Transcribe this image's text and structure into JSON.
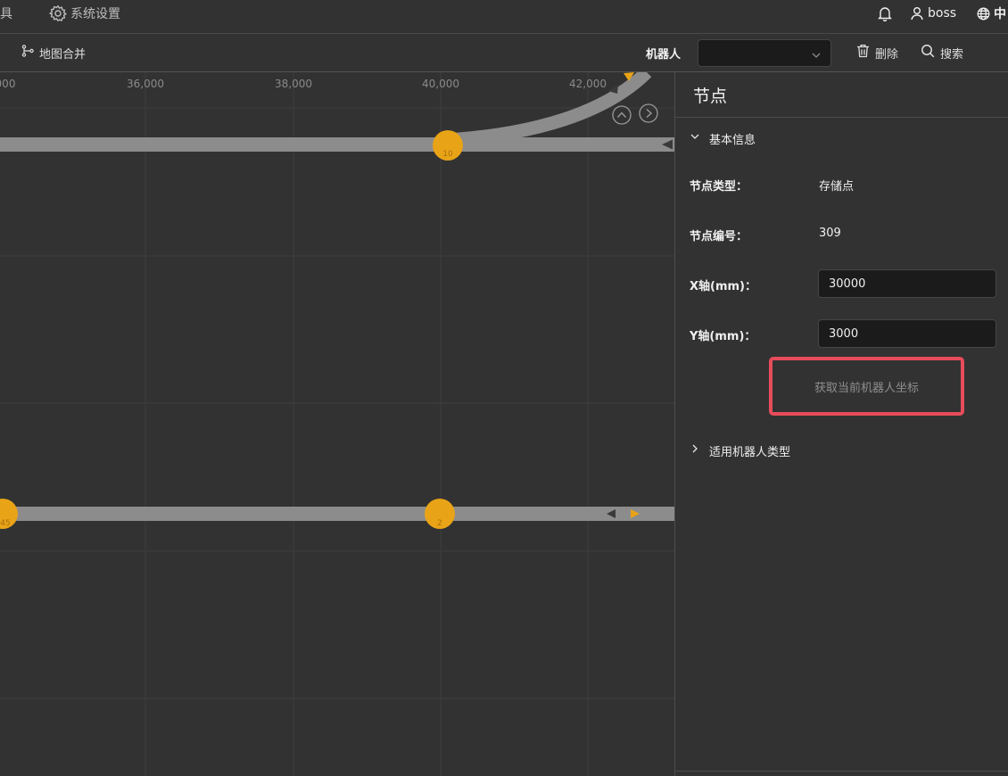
{
  "topbar": {
    "left_fragment": "具",
    "system_settings": "系统设置",
    "user": "boss",
    "language": "中"
  },
  "toolbar": {
    "map_merge": "地图合并",
    "robot_label": "机器人",
    "robot_select_value": "",
    "delete": "删除",
    "search": "搜索"
  },
  "map": {
    "x_ticks": [
      "000",
      "36,000",
      "38,000",
      "40,000",
      "42,000"
    ],
    "nodes": [
      {
        "id": "10"
      },
      {
        "id": "45"
      },
      {
        "id": "2"
      }
    ]
  },
  "panel": {
    "title": "节点",
    "basic_info": "基本信息",
    "node_type_label": "节点类型：",
    "node_type_value": "存储点",
    "node_id_label": "节点编号：",
    "node_id_value": "309",
    "x_label": "X轴(mm)：",
    "x_value": "30000",
    "y_label": "Y轴(mm)：",
    "y_value": "3000",
    "get_robot_coord": "获取当前机器人坐标",
    "robot_types": "适用机器人类型"
  },
  "colors": {
    "background": "#323232",
    "node": "#e8a317",
    "path": "#8c8c8c",
    "highlight": "#e74c5b"
  }
}
